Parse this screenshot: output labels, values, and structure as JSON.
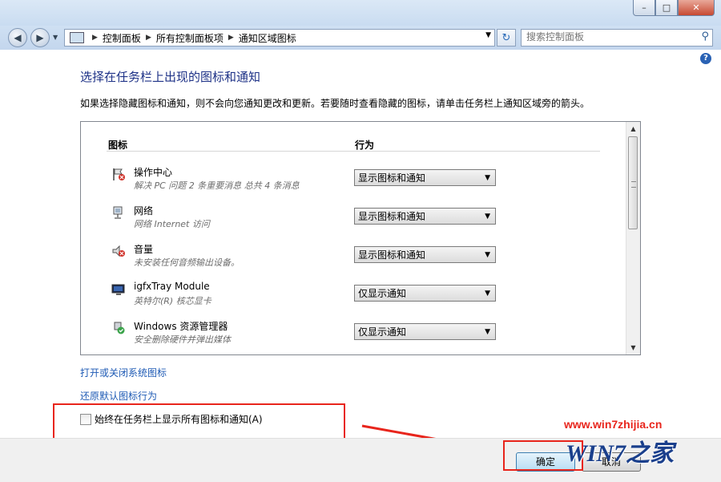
{
  "window": {
    "min": "–",
    "max": "□",
    "close": "✕"
  },
  "nav": {
    "back": "◀",
    "forward": "▶",
    "breadcrumb": [
      "控制面板",
      "所有控制面板项",
      "通知区域图标"
    ],
    "search_placeholder": "搜索控制面板"
  },
  "page": {
    "title": "选择在任务栏上出现的图标和通知",
    "description": "如果选择隐藏图标和通知，则不会向您通知更改和更新。若要随时查看隐藏的图标，请单击任务栏上通知区域旁的箭头。"
  },
  "table": {
    "col_icon": "图标",
    "col_behavior": "行为",
    "rows": [
      {
        "icon": "flag-icon",
        "name": "操作中心",
        "sub": "解决 PC 问题  2 条重要消息  总共 4 条消息",
        "behavior": "显示图标和通知"
      },
      {
        "icon": "network-icon",
        "name": "网络",
        "sub": "网络 Internet 访问",
        "behavior": "显示图标和通知"
      },
      {
        "icon": "volume-icon",
        "name": "音量",
        "sub": "未安装任何音频输出设备。",
        "behavior": "显示图标和通知"
      },
      {
        "icon": "monitor-icon",
        "name": "igfxTray Module",
        "sub": "英特尔(R) 核芯显卡",
        "behavior": "仅显示通知"
      },
      {
        "icon": "safe-remove-icon",
        "name": "Windows 资源管理器",
        "sub": "安全删除硬件并弹出媒体",
        "behavior": "仅显示通知"
      }
    ]
  },
  "links": {
    "system_icons": "打开或关闭系统图标",
    "restore": "还原默认图标行为"
  },
  "checkbox": {
    "label": "始终在任务栏上显示所有图标和通知(A)",
    "checked": false
  },
  "footer": {
    "ok": "确定",
    "cancel": "取消"
  },
  "watermark": {
    "url": "www.win7zhijia.cn",
    "logo": "WIN7之家"
  },
  "colors": {
    "title": "#1e3287",
    "link": "#1f5bb5",
    "annotation": "#e8251c"
  }
}
